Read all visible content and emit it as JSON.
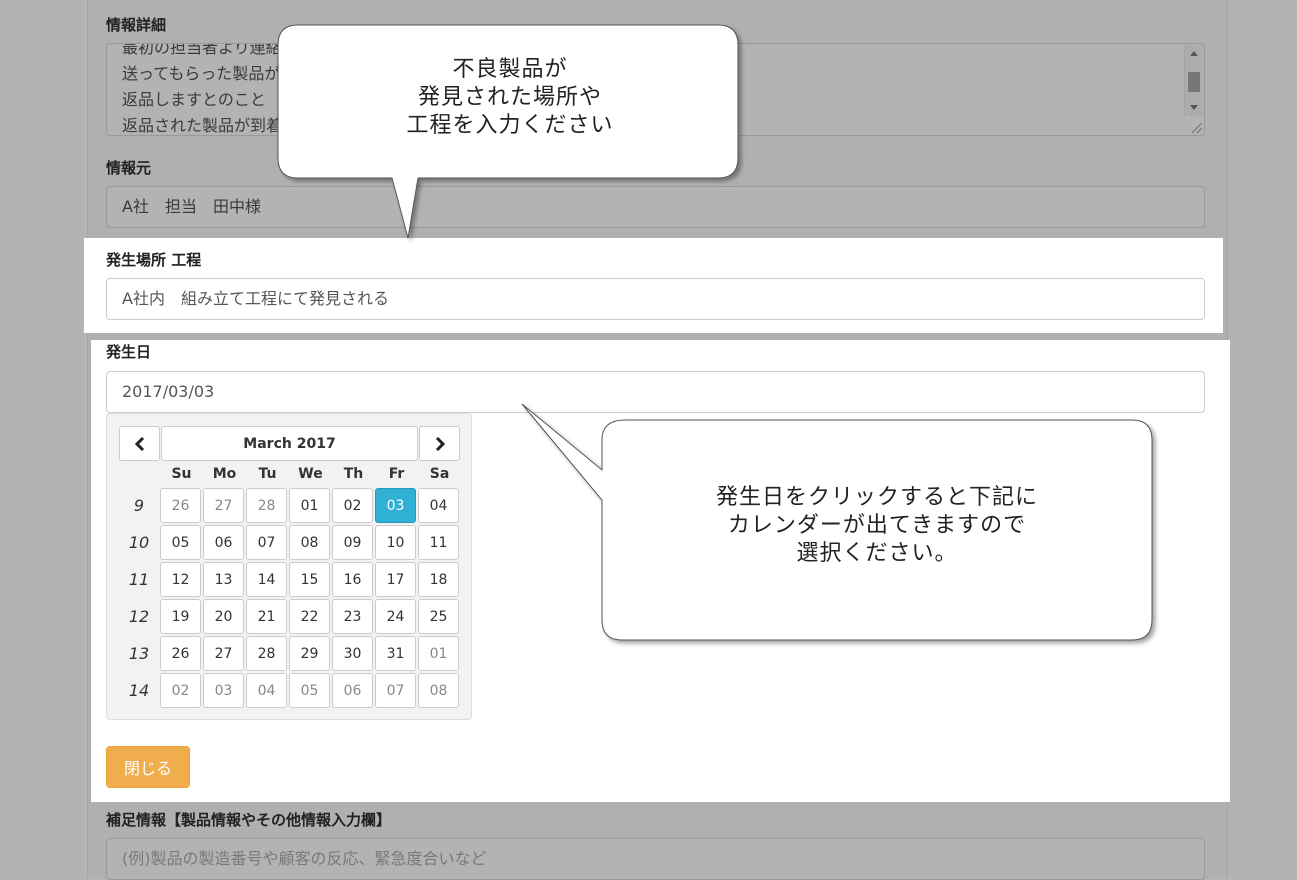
{
  "info_detail": {
    "label": "情報詳細",
    "lines": [
      "最初の担当者より連絡あり",
      "送ってもらった製品が不良でした",
      "返品しますとのこと",
      "返品された製品が到着しました"
    ]
  },
  "info_source": {
    "label": "情報元",
    "value": "A社　担当　田中様"
  },
  "location": {
    "label": "発生場所 工程",
    "value": "A社内　組み立て工程にて発見される"
  },
  "occurrence_date": {
    "label": "発生日",
    "value": "2017/03/03"
  },
  "calendar": {
    "title": "March 2017",
    "prev_icon": "chevron-left-icon",
    "next_icon": "chevron-right-icon",
    "weekdays": [
      "Su",
      "Mo",
      "Tu",
      "We",
      "Th",
      "Fr",
      "Sa"
    ],
    "weeks": [
      {
        "number": "9",
        "days": [
          {
            "d": "26",
            "muted": true
          },
          {
            "d": "27",
            "muted": true
          },
          {
            "d": "28",
            "muted": true
          },
          {
            "d": "01"
          },
          {
            "d": "02"
          },
          {
            "d": "03",
            "active": true
          },
          {
            "d": "04"
          }
        ]
      },
      {
        "number": "10",
        "days": [
          {
            "d": "05"
          },
          {
            "d": "06"
          },
          {
            "d": "07"
          },
          {
            "d": "08"
          },
          {
            "d": "09"
          },
          {
            "d": "10"
          },
          {
            "d": "11"
          }
        ]
      },
      {
        "number": "11",
        "days": [
          {
            "d": "12"
          },
          {
            "d": "13"
          },
          {
            "d": "14"
          },
          {
            "d": "15"
          },
          {
            "d": "16"
          },
          {
            "d": "17"
          },
          {
            "d": "18"
          }
        ]
      },
      {
        "number": "12",
        "days": [
          {
            "d": "19"
          },
          {
            "d": "20"
          },
          {
            "d": "21"
          },
          {
            "d": "22"
          },
          {
            "d": "23"
          },
          {
            "d": "24"
          },
          {
            "d": "25"
          }
        ]
      },
      {
        "number": "13",
        "days": [
          {
            "d": "26"
          },
          {
            "d": "27"
          },
          {
            "d": "28"
          },
          {
            "d": "29"
          },
          {
            "d": "30"
          },
          {
            "d": "31"
          },
          {
            "d": "01",
            "muted": true
          }
        ]
      },
      {
        "number": "14",
        "days": [
          {
            "d": "02",
            "muted": true
          },
          {
            "d": "03",
            "muted": true
          },
          {
            "d": "04",
            "muted": true
          },
          {
            "d": "05",
            "muted": true
          },
          {
            "d": "06",
            "muted": true
          },
          {
            "d": "07",
            "muted": true
          },
          {
            "d": "08",
            "muted": true
          }
        ]
      }
    ]
  },
  "close_button": {
    "label": "閉じる",
    "color": "#f0ad4e"
  },
  "supplement": {
    "label": "補足情報【製品情報やその他情報入力欄】",
    "placeholder": "(例)製品の製造番号や顧客の反応、緊急度合いなど"
  },
  "callout_top": {
    "lines": [
      "不良製品が",
      "発見された場所や",
      "工程を入力ください"
    ]
  },
  "callout_right": {
    "lines": [
      "発生日をクリックすると下記に",
      "カレンダーが出てきますので",
      "選択ください。"
    ]
  },
  "colors": {
    "accent_active": "#31b0d5",
    "overlay": "#b3b3b3"
  }
}
